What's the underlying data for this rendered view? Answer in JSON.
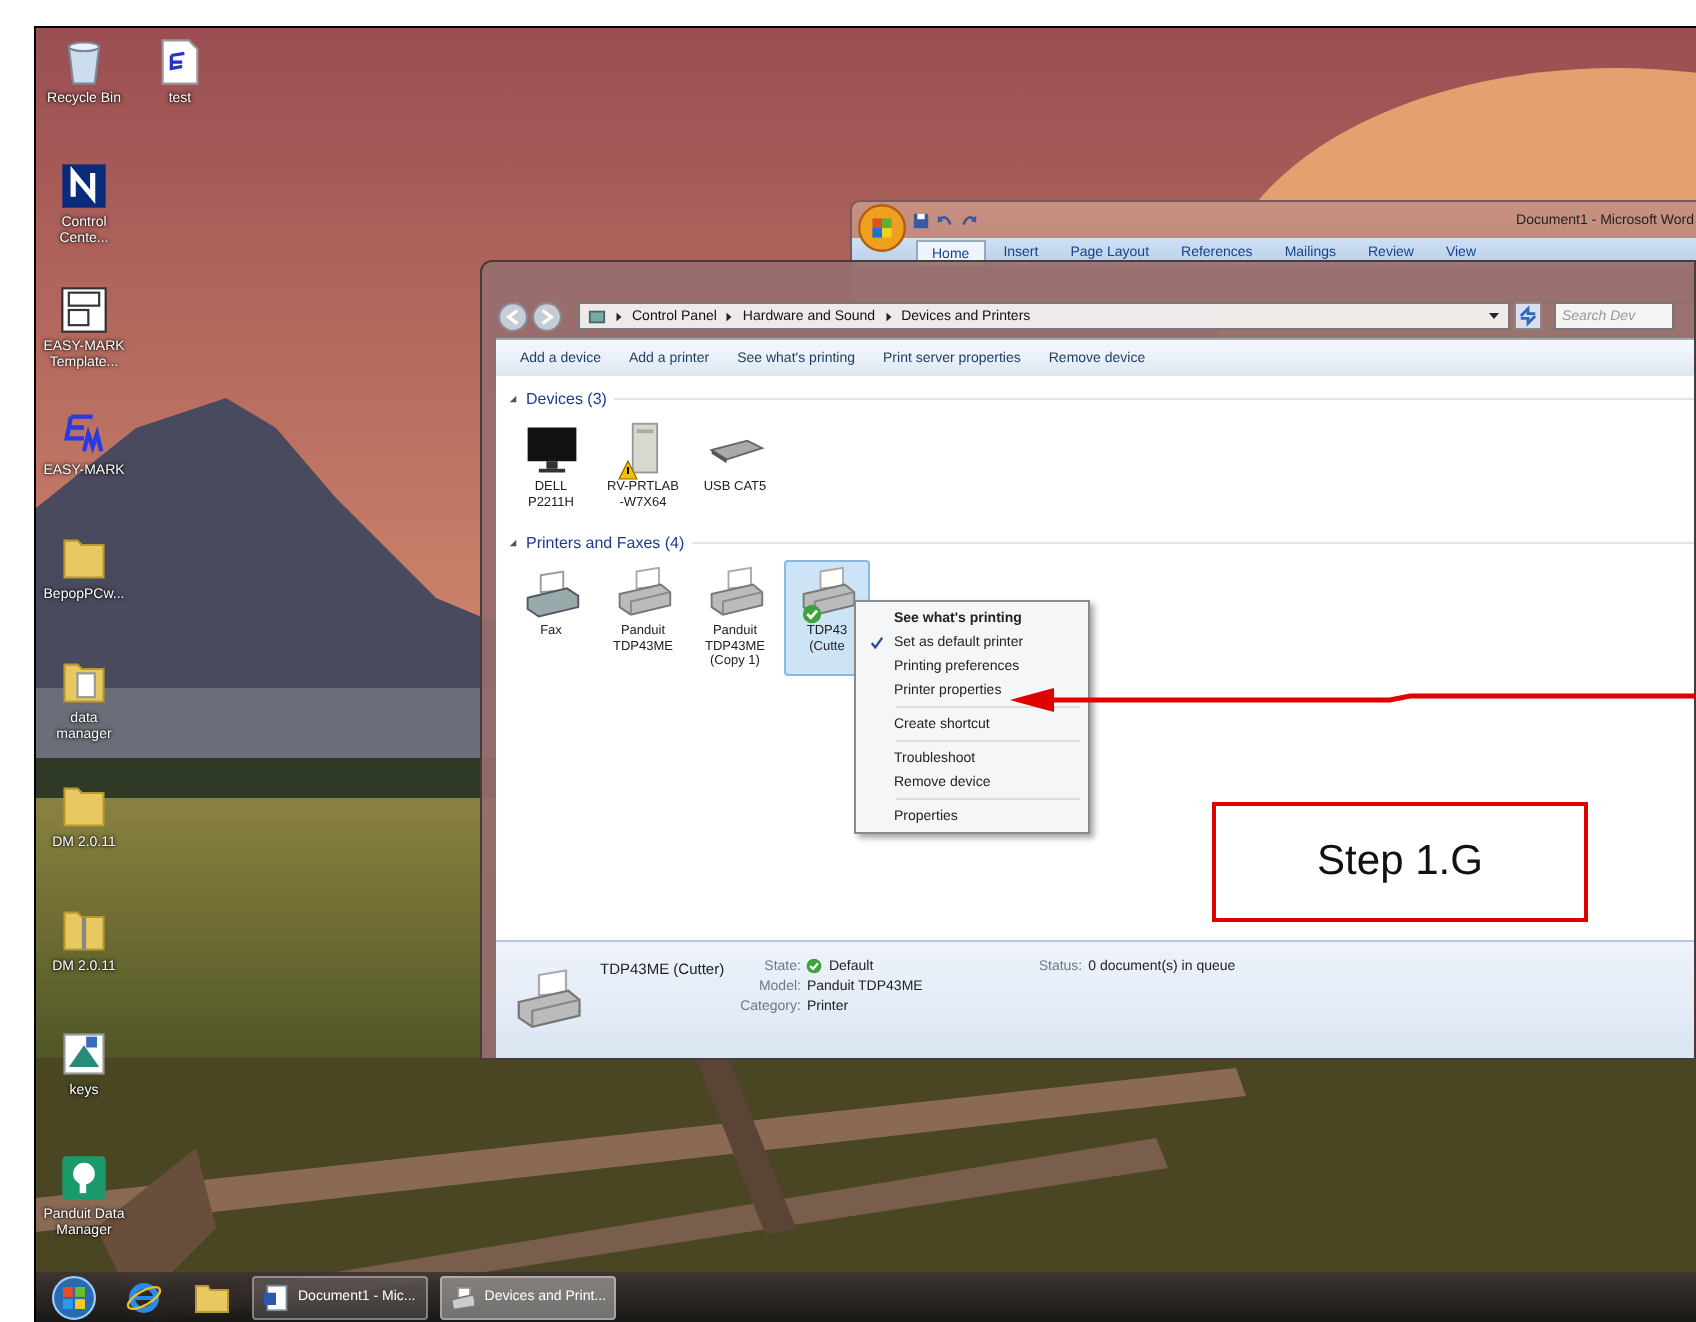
{
  "desktop_icons": [
    {
      "label": "Recycle Bin",
      "kind": "bin"
    },
    {
      "label": "test",
      "kind": "em-doc"
    },
    {
      "label": "Control\nCente...",
      "kind": "n-app"
    },
    {
      "label": "EASY-MARK\nTemplate...",
      "kind": "template"
    },
    {
      "label": "EASY-MARK",
      "kind": "em-app"
    },
    {
      "label": "BepopPCw...",
      "kind": "folder"
    },
    {
      "label": "data\nmanager",
      "kind": "folder-doc"
    },
    {
      "label": "DM 2.0.11",
      "kind": "folder"
    },
    {
      "label": "DM 2.0.11",
      "kind": "folder-zip"
    },
    {
      "label": "keys",
      "kind": "keys"
    },
    {
      "label": "Panduit Data\nManager",
      "kind": "panduit"
    }
  ],
  "word_window": {
    "title": "Document1 - Microsoft Word",
    "ribbon_tabs": [
      {
        "label": "Home",
        "selected": true
      },
      {
        "label": "Insert",
        "selected": false
      },
      {
        "label": "Page Layout",
        "selected": false
      },
      {
        "label": "References",
        "selected": false
      },
      {
        "label": "Mailings",
        "selected": false
      },
      {
        "label": "Review",
        "selected": false
      },
      {
        "label": "View",
        "selected": false
      }
    ]
  },
  "explorer": {
    "breadcrumb": [
      "Control Panel",
      "Hardware and Sound",
      "Devices and Printers"
    ],
    "search": {
      "placeholder": "Search Dev"
    },
    "toolbar": [
      "Add a device",
      "Add a printer",
      "See what's printing",
      "Print server properties",
      "Remove device"
    ],
    "groups": [
      {
        "title": "Devices (3)",
        "expanded": true,
        "items": [
          {
            "label": "DELL\nP2211H",
            "kind": "monitor",
            "selected": false
          },
          {
            "label": "RV-PRTLAB\n-W7X64",
            "kind": "server",
            "warning": true,
            "selected": false
          },
          {
            "label": "USB CAT5",
            "kind": "usb",
            "selected": false
          }
        ]
      },
      {
        "title": "Printers and Faxes (4)",
        "expanded": true,
        "items": [
          {
            "label": "Fax",
            "kind": "fax",
            "selected": false
          },
          {
            "label": "Panduit\nTDP43ME",
            "kind": "printer",
            "selected": false
          },
          {
            "label": "Panduit\nTDP43ME\n(Copy 1)",
            "kind": "printer",
            "selected": false
          },
          {
            "label": "TDP43\n(Cutte",
            "kind": "printer",
            "is_default": true,
            "selected": true
          }
        ]
      }
    ],
    "details": {
      "name": "TDP43ME (Cutter)",
      "fields": [
        {
          "label": "State:",
          "value": "Default",
          "is_default": true
        },
        {
          "label": "Model:",
          "value": "Panduit TDP43ME"
        },
        {
          "label": "Category:",
          "value": "Printer"
        }
      ],
      "status": {
        "label": "Status:",
        "value": "0 document(s) in queue"
      }
    }
  },
  "context_menu": {
    "groups": [
      [
        {
          "label": "See what's printing",
          "bold": true,
          "checked": false
        },
        {
          "label": "Set as default printer",
          "bold": false,
          "checked": true
        },
        {
          "label": "Printing preferences",
          "bold": false,
          "checked": false
        },
        {
          "label": "Printer properties",
          "bold": false,
          "checked": false
        }
      ],
      [
        {
          "label": "Create shortcut",
          "bold": false,
          "checked": false
        }
      ],
      [
        {
          "label": "Troubleshoot",
          "bold": false,
          "checked": false
        },
        {
          "label": "Remove device",
          "bold": false,
          "checked": false
        }
      ],
      [
        {
          "label": "Properties",
          "bold": false,
          "checked": false
        }
      ]
    ]
  },
  "annotation": {
    "label": "Step 1.G"
  },
  "taskbar": {
    "pinned": [
      {
        "kind": "start"
      },
      {
        "kind": "ie"
      },
      {
        "kind": "folder"
      }
    ],
    "buttons": [
      {
        "label": "Document1 - Mic...",
        "kind": "word",
        "selected": false
      },
      {
        "label": "Devices and Print...",
        "kind": "printer",
        "selected": true
      }
    ]
  }
}
